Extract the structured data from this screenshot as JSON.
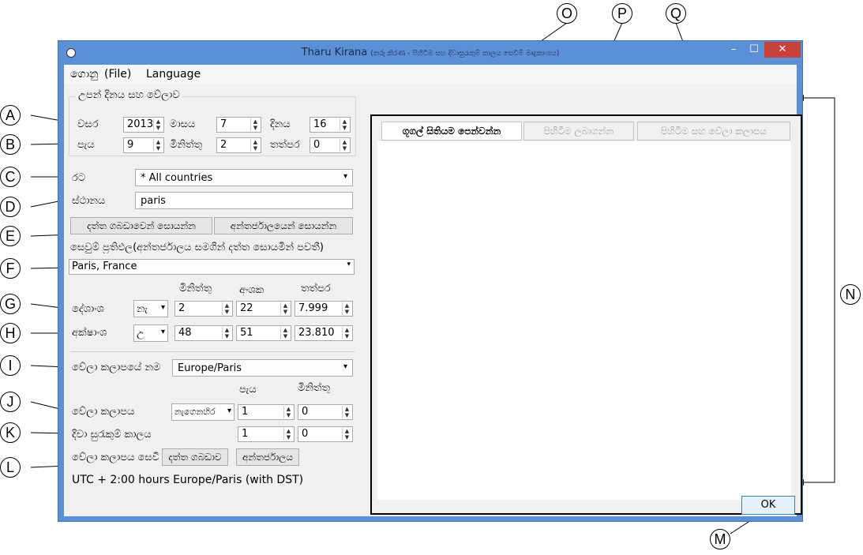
{
  "window": {
    "title": "Tharu Kirana",
    "title_sub": "(තරු කිරණ - පිහිටීම සහ දිවාසුරැකුම් කාලය සෙවීම් මෘදුකාංගය)",
    "min_glyph": "–",
    "max_glyph": "☐",
    "close_glyph": "✕"
  },
  "menu": {
    "file_si": "ගොනු",
    "file_en": "(File)",
    "language": "Language"
  },
  "birth_group": {
    "legend": "උපන් දිනය සහ වේලාව",
    "year_label": "වසර",
    "year": "2013",
    "month_label": "මාසය",
    "month": "7",
    "day_label": "දිනය",
    "day": "16",
    "hour_label": "පැය",
    "hour": "9",
    "minute_label": "මිනිත්තු",
    "minute": "2",
    "second_label": "තත්පර",
    "second": "0"
  },
  "location": {
    "country_label": "රට",
    "country": "* All countries",
    "place_label": "ස්ථානය",
    "place": "paris",
    "db_search_button": "දත්ත ගබඩාවෙන් සොයන්න",
    "web_search_button": "අන්තර්ජාලයෙන් සොයන්න",
    "result_note": "සෙවුම් ප්‍රතිඵල(අන්තර්ජාලය සමගින් දත්ත සොයමින් පවතී)",
    "result": "Paris, France",
    "col_minutes": "මිනිත්තු",
    "col_degrees": "අංශක",
    "col_seconds": "තත්පර",
    "longitude_label": "දේශාංශ",
    "longitude_dir": "නැ",
    "longitude_min": "2",
    "longitude_deg": "22",
    "longitude_sec": "7.999",
    "latitude_label": "අක්ෂාංශ",
    "latitude_dir": "උ",
    "latitude_min": "48",
    "latitude_deg": "51",
    "latitude_sec": "23.810"
  },
  "timezone": {
    "zone_label": "වේලා කලාපයේ නම",
    "zone": "Europe/Paris",
    "col_hours": "පැය",
    "col_minutes": "මිනිත්තු",
    "offset_label": "වේලා කලාපය",
    "offset_dir": "නැගෙනහිර",
    "offset_hours": "1",
    "offset_minutes": "0",
    "dst_label": "දිවා සුරැකුම් කාලය",
    "dst_hours": "1",
    "dst_minutes": "0",
    "find_label": "වේලා කලාපය සෙවීම",
    "find_db_button": "දත්ත ගබඩාව",
    "find_web_button": "අන්තර්ජාලය",
    "summary": "UTC + 2:00 hours Europe/Paris (with DST)"
  },
  "tabs": [
    {
      "label": "ගූගල් සිතියම පෙන්වන්න"
    },
    {
      "label": "පිහිටීම ලබාගන්න"
    },
    {
      "label": "පිහිටීම සහ වේලා කලාපය"
    }
  ],
  "ok_button": "OK",
  "callouts": {
    "A": "A",
    "B": "B",
    "C": "C",
    "D": "D",
    "E": "E",
    "F": "F",
    "G": "G",
    "H": "H",
    "I": "I",
    "J": "J",
    "K": "K",
    "L": "L",
    "M": "M",
    "N": "N",
    "O": "O",
    "P": "P",
    "Q": "Q"
  },
  "icons": {
    "spin": "⬍",
    "dropdown": "▾",
    "app": "clock-icon"
  }
}
